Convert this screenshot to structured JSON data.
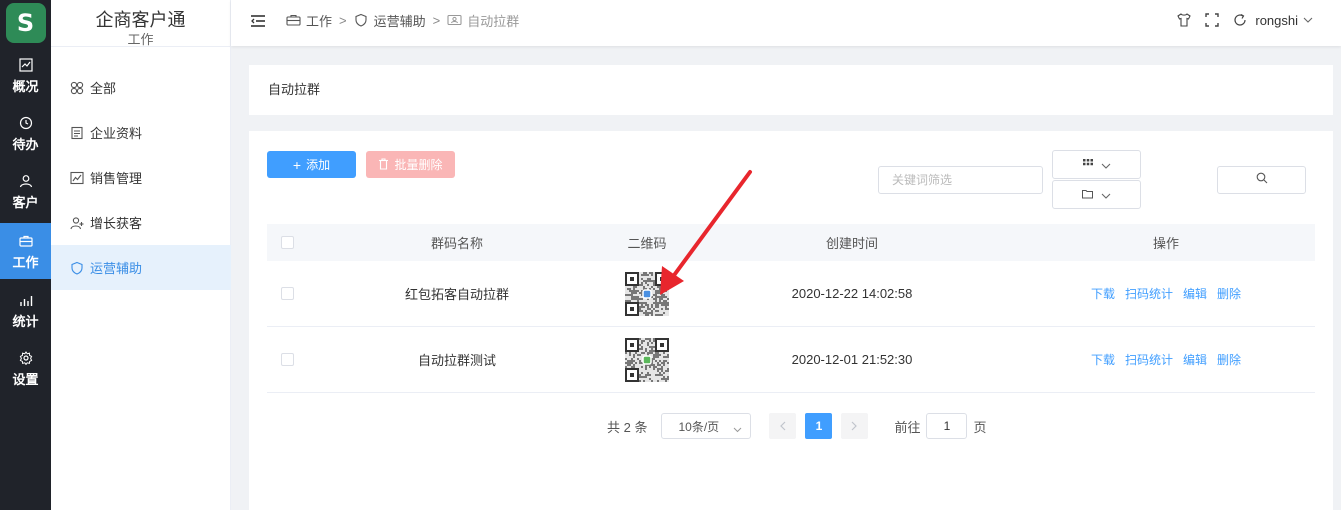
{
  "app": {
    "title": "企商客户通",
    "section": "工作",
    "logo_letter": "S",
    "brand_color": "#2e8b57"
  },
  "nav": [
    {
      "label": "概况",
      "icon": "chart-line-icon"
    },
    {
      "label": "待办",
      "icon": "clock-icon"
    },
    {
      "label": "客户",
      "icon": "user-icon"
    },
    {
      "label": "工作",
      "icon": "briefcase-icon",
      "active": true
    },
    {
      "label": "统计",
      "icon": "bar-chart-icon"
    },
    {
      "label": "设置",
      "icon": "gear-icon"
    }
  ],
  "sidebar": [
    {
      "label": "全部",
      "icon": "grid-icon"
    },
    {
      "label": "企业资料",
      "icon": "document-icon"
    },
    {
      "label": "销售管理",
      "icon": "sales-chart-icon"
    },
    {
      "label": "增长获客",
      "icon": "user-add-icon"
    },
    {
      "label": "运营辅助",
      "icon": "shield-icon",
      "active": true
    }
  ],
  "header": {
    "breadcrumbs": [
      "工作",
      "运营辅助",
      "自动拉群"
    ],
    "separator": ">",
    "username": "rongshi"
  },
  "page": {
    "title": "自动拉群"
  },
  "toolbar": {
    "add_label": "添加",
    "batch_delete_label": "批量删除",
    "keyword_placeholder": "关键词筛选"
  },
  "table": {
    "columns": [
      "群码名称",
      "二维码",
      "创建时间",
      "操作"
    ],
    "rows": [
      {
        "name": "红包拓客自动拉群",
        "created": "2020-12-22 14:02:58",
        "qr_center_color": "#4a90e2"
      },
      {
        "name": "自动拉群测试",
        "created": "2020-12-01 21:52:30",
        "qr_center_color": "#5cb85c"
      }
    ],
    "actions": [
      "下载",
      "扫码统计",
      "编辑",
      "删除"
    ]
  },
  "pagination": {
    "total_text": "共 2 条",
    "page_size": "10条/页",
    "current_page": "1",
    "goto_label": "前往",
    "goto_value": "1",
    "page_unit": "页"
  },
  "colors": {
    "primary": "#409eff",
    "danger_disabled": "#fab6b6",
    "nav_bg": "#20232a",
    "annotation_arrow": "#e8262d"
  }
}
